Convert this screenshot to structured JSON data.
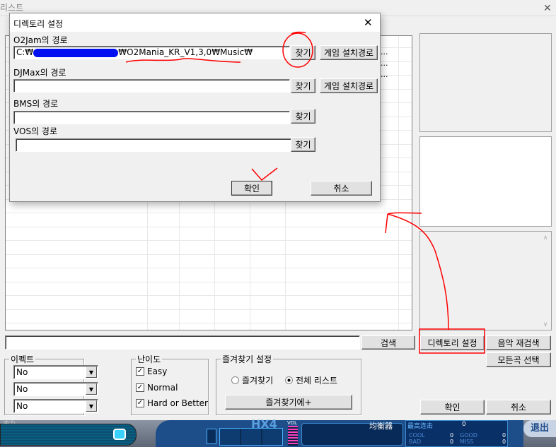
{
  "main_window": {
    "title": "리스트",
    "close": "✕"
  },
  "list": {
    "truncated_cells": [
      "...",
      "...",
      "..."
    ]
  },
  "search": {
    "value": "",
    "button": "검색"
  },
  "buttons": {
    "dir_settings": "디렉토리 설정",
    "rescan": "음악 재검색",
    "select_all": "모든곡 선택",
    "ok": "확인",
    "cancel": "취소"
  },
  "effect": {
    "label": "이펙트",
    "selects": [
      "No",
      "No",
      "No"
    ]
  },
  "difficulty": {
    "label": "난이도",
    "items": [
      {
        "label": "Easy",
        "checked": true
      },
      {
        "label": "Normal",
        "checked": true
      },
      {
        "label": "Hard or Better",
        "checked": true
      }
    ]
  },
  "favorites": {
    "label": "즐겨찾기 설정",
    "radio_fav": "즐겨찾기",
    "radio_all": "전체 리스트",
    "selected": "전체 리스트",
    "add_button": "즐겨찾기에+"
  },
  "dialog": {
    "title": "디렉토리 설정",
    "close": "✕",
    "o2jam": {
      "label": "O2Jam의 경로",
      "value_prefix": "C:₩",
      "value_suffix": "₩O2Mania_KR_V1,3,0₩Music₩",
      "browse": "찾기",
      "install": "게임 설치경로"
    },
    "djmax": {
      "label": "DJMax의 경로",
      "value": "",
      "browse": "찾기",
      "install": "게임 설치경로"
    },
    "bms": {
      "label": "BMS의 경로",
      "value": "",
      "browse": "찾기"
    },
    "vos": {
      "label": "VOS의 경로",
      "value": "",
      "browse": "찾기"
    },
    "ok": "확인",
    "cancel": "취소"
  },
  "game_bar": {
    "logo": "HX4",
    "vol": "VOL",
    "equalizer": "均衡器",
    "max_combo": "最高连击",
    "max_combo_value": "0",
    "cool": "COOL",
    "cool_value": "0",
    "good": "GOOD",
    "good_value": "0",
    "bad": "BAD",
    "bad_value": "0",
    "miss": "MISS",
    "miss_value": "0",
    "exit": "退出",
    "speed_label": "速力"
  }
}
